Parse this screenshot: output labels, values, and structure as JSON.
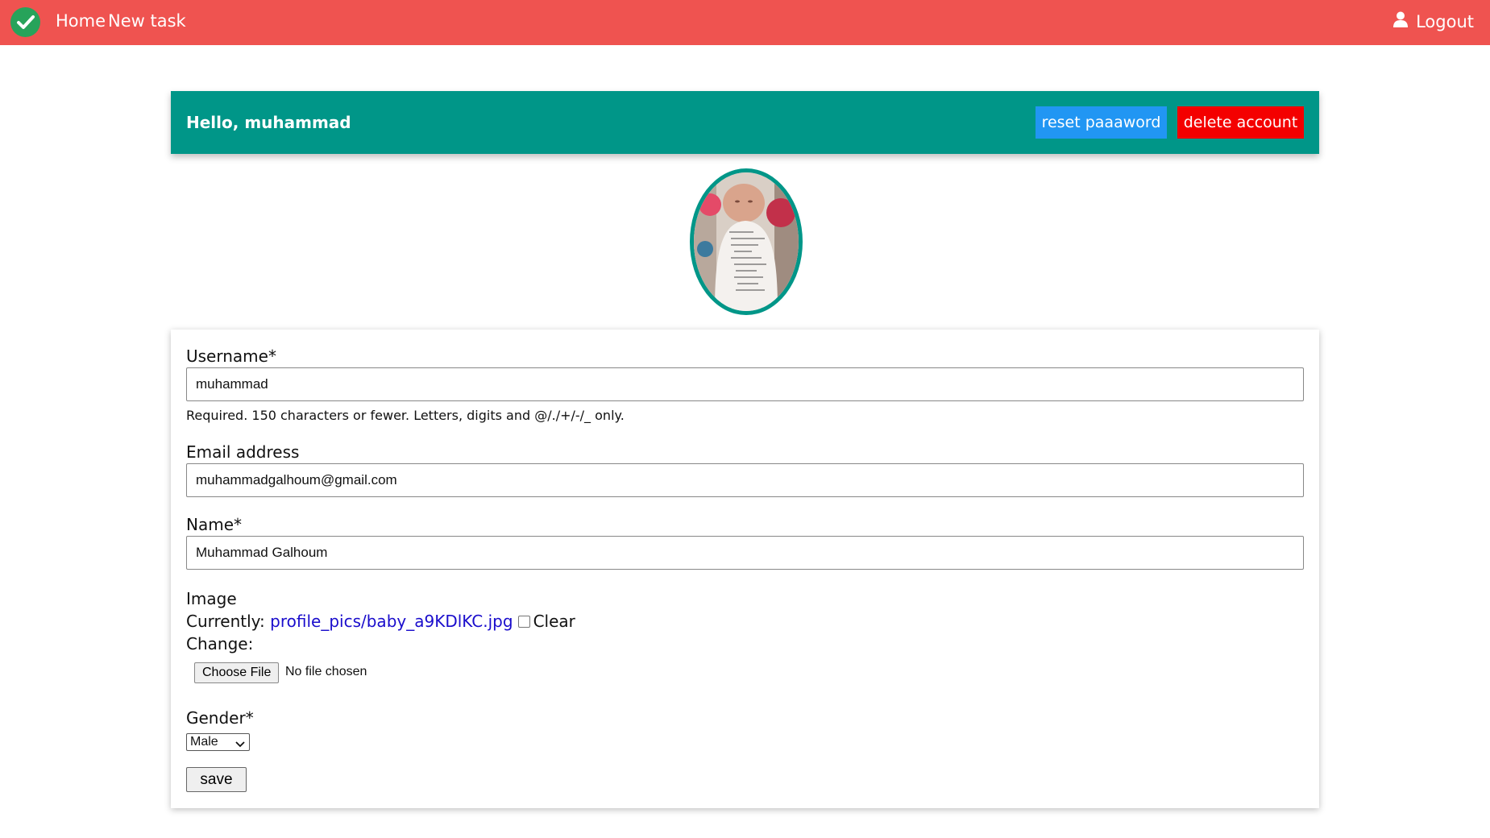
{
  "nav": {
    "home": "Home",
    "new_task": "New task",
    "logout": "Logout"
  },
  "header": {
    "greeting": "Hello, muhammad",
    "reset_label": "reset paaaword",
    "delete_label": "delete account"
  },
  "form": {
    "username_label": "Username*",
    "username_value": "muhammad",
    "username_help": "Required. 150 characters or fewer. Letters, digits and @/./+/-/_ only.",
    "email_label": "Email address",
    "email_value": "muhammadgalhoum@gmail.com",
    "name_label": "Name*",
    "name_value": "Muhammad Galhoum",
    "image_label": "Image",
    "currently_label": "Currently:",
    "current_file": "profile_pics/baby_a9KDlKC.jpg",
    "clear_label": "Clear",
    "change_label": "Change:",
    "choose_file_label": "Choose File",
    "no_file_text": "No file chosen",
    "gender_label": "Gender*",
    "gender_value": "Male",
    "save_label": "save"
  },
  "colors": {
    "topbar": "#ef5350",
    "header": "#009688",
    "reset_button": "#2196f3",
    "delete_button": "#f40000",
    "link": "#1a0dcc"
  }
}
